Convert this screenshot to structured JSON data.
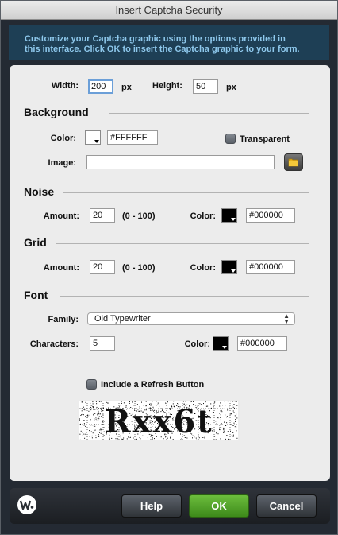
{
  "window": {
    "title": "Insert Captcha Security"
  },
  "intro": {
    "line1": "Customize your Captcha graphic using the options provided in",
    "line2": "this interface. Click OK to insert the Captcha graphic to your form."
  },
  "size": {
    "width_label": "Width:",
    "width_value": "200",
    "width_unit": "px",
    "height_label": "Height:",
    "height_value": "50",
    "height_unit": "px"
  },
  "background": {
    "heading": "Background",
    "color_label": "Color:",
    "color_value": "#FFFFFF",
    "transparent_label": "Transparent",
    "image_label": "Image:",
    "image_value": ""
  },
  "noise": {
    "heading": "Noise",
    "amount_label": "Amount:",
    "amount_value": "20",
    "range": "(0 - 100)",
    "color_label": "Color:",
    "color_value": "#000000"
  },
  "grid": {
    "heading": "Grid",
    "amount_label": "Amount:",
    "amount_value": "20",
    "range": "(0 - 100)",
    "color_label": "Color:",
    "color_value": "#000000"
  },
  "font": {
    "heading": "Font",
    "family_label": "Family:",
    "family_value": "Old Typewriter",
    "characters_label": "Characters:",
    "characters_value": "5",
    "color_label": "Color:",
    "color_value": "#000000"
  },
  "refresh": {
    "label": "Include a Refresh Button"
  },
  "captcha": {
    "text": "Rxx6t"
  },
  "footer": {
    "help": "Help",
    "ok": "OK",
    "cancel": "Cancel"
  },
  "colors": {
    "accent_blue": "#8ec8ec",
    "ok_green": "#4ea22a",
    "panel": "#ececec"
  }
}
